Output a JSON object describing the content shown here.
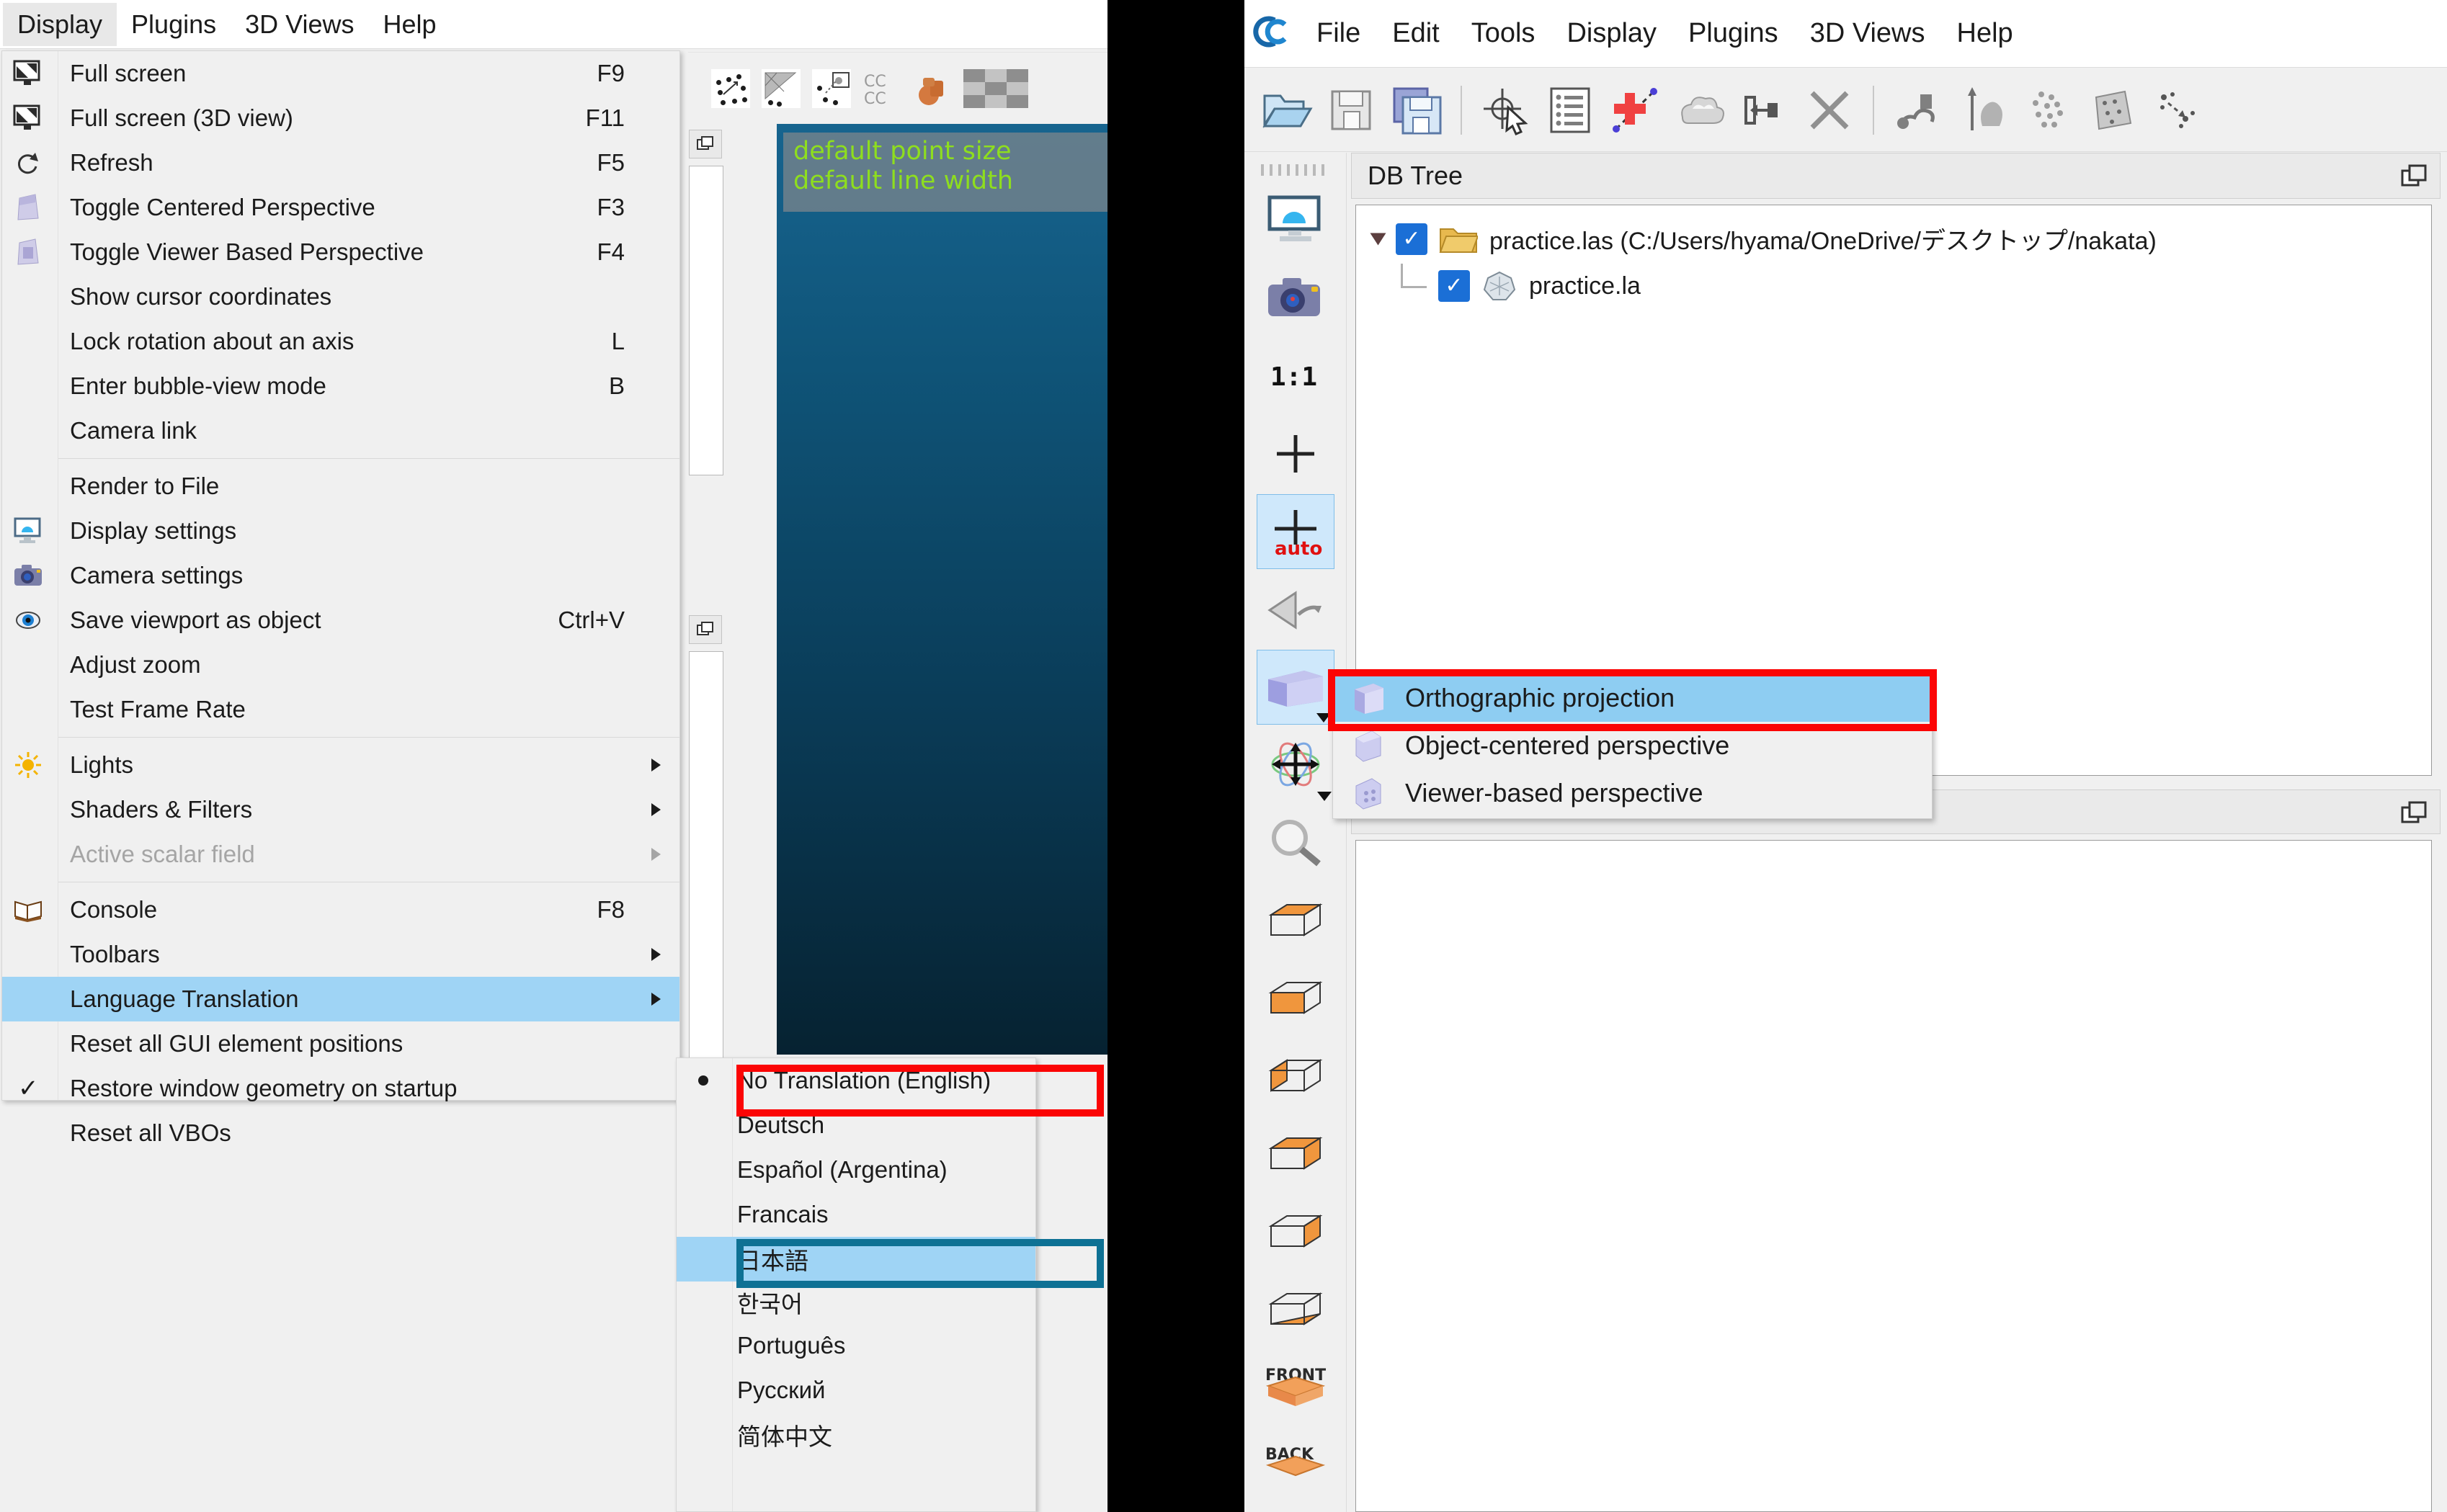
{
  "left_window": {
    "menubar": {
      "items": [
        {
          "label": "Display",
          "active": true
        },
        {
          "label": "Plugins",
          "active": false
        },
        {
          "label": "3D Views",
          "active": false
        },
        {
          "label": "Help",
          "active": false
        }
      ]
    },
    "display_menu": {
      "groups": [
        {
          "items": [
            {
              "label": "Full screen",
              "shortcut": "F9",
              "icon": "fullscreen-icon",
              "arrow": false,
              "checked": false,
              "disabled": false,
              "highlighted": false
            },
            {
              "label": "Full screen (3D view)",
              "shortcut": "F11",
              "icon": "fullscreen-3d-icon",
              "arrow": false,
              "checked": false,
              "disabled": false,
              "highlighted": false
            },
            {
              "label": "Refresh",
              "shortcut": "F5",
              "icon": "refresh-icon",
              "arrow": false,
              "checked": false,
              "disabled": false,
              "highlighted": false
            },
            {
              "label": "Toggle Centered Perspective",
              "shortcut": "F3",
              "icon": "centered-perspective-icon",
              "arrow": false,
              "checked": false,
              "disabled": false,
              "highlighted": false
            },
            {
              "label": "Toggle Viewer Based Perspective",
              "shortcut": "F4",
              "icon": "viewer-perspective-icon",
              "arrow": false,
              "checked": false,
              "disabled": false,
              "highlighted": false
            },
            {
              "label": "Show cursor coordinates",
              "shortcut": "",
              "icon": "",
              "arrow": false,
              "checked": false,
              "disabled": false,
              "highlighted": false
            },
            {
              "label": "Lock rotation about an axis",
              "shortcut": "L",
              "icon": "",
              "arrow": false,
              "checked": false,
              "disabled": false,
              "highlighted": false
            },
            {
              "label": "Enter bubble-view mode",
              "shortcut": "B",
              "icon": "",
              "arrow": false,
              "checked": false,
              "disabled": false,
              "highlighted": false
            },
            {
              "label": "Camera link",
              "shortcut": "",
              "icon": "",
              "arrow": false,
              "checked": false,
              "disabled": false,
              "highlighted": false
            }
          ]
        },
        {
          "items": [
            {
              "label": "Render to File",
              "shortcut": "",
              "icon": "",
              "arrow": false,
              "checked": false,
              "disabled": false,
              "highlighted": false
            },
            {
              "label": "Display settings",
              "shortcut": "",
              "icon": "display-settings-icon",
              "arrow": false,
              "checked": false,
              "disabled": false,
              "highlighted": false
            },
            {
              "label": "Camera settings",
              "shortcut": "",
              "icon": "camera-icon",
              "arrow": false,
              "checked": false,
              "disabled": false,
              "highlighted": false
            },
            {
              "label": "Save viewport as object",
              "shortcut": "Ctrl+V",
              "icon": "eye-icon",
              "arrow": false,
              "checked": false,
              "disabled": false,
              "highlighted": false
            },
            {
              "label": "Adjust zoom",
              "shortcut": "",
              "icon": "",
              "arrow": false,
              "checked": false,
              "disabled": false,
              "highlighted": false
            },
            {
              "label": "Test Frame Rate",
              "shortcut": "",
              "icon": "",
              "arrow": false,
              "checked": false,
              "disabled": false,
              "highlighted": false
            }
          ]
        },
        {
          "items": [
            {
              "label": "Lights",
              "shortcut": "",
              "icon": "sun-icon",
              "arrow": true,
              "checked": false,
              "disabled": false,
              "highlighted": false
            },
            {
              "label": "Shaders & Filters",
              "shortcut": "",
              "icon": "",
              "arrow": true,
              "checked": false,
              "disabled": false,
              "highlighted": false
            },
            {
              "label": "Active scalar field",
              "shortcut": "",
              "icon": "",
              "arrow": true,
              "checked": false,
              "disabled": true,
              "highlighted": false
            }
          ]
        },
        {
          "items": [
            {
              "label": "Console",
              "shortcut": "F8",
              "icon": "book-icon",
              "arrow": false,
              "checked": false,
              "disabled": false,
              "highlighted": false
            },
            {
              "label": "Toolbars",
              "shortcut": "",
              "icon": "",
              "arrow": true,
              "checked": false,
              "disabled": false,
              "highlighted": false
            },
            {
              "label": "Language Translation",
              "shortcut": "",
              "icon": "",
              "arrow": true,
              "checked": false,
              "disabled": false,
              "highlighted": true
            },
            {
              "label": "Reset all GUI element positions",
              "shortcut": "",
              "icon": "",
              "arrow": false,
              "checked": false,
              "disabled": false,
              "highlighted": false
            },
            {
              "label": "Restore window geometry on startup",
              "shortcut": "",
              "icon": "",
              "arrow": false,
              "checked": true,
              "disabled": false,
              "highlighted": false
            },
            {
              "label": "Reset all VBOs",
              "shortcut": "",
              "icon": "",
              "arrow": false,
              "checked": false,
              "disabled": false,
              "highlighted": false
            }
          ]
        }
      ]
    },
    "language_submenu": {
      "items": [
        {
          "label": "No Translation (English)",
          "radio": true,
          "selected": false,
          "outline": "red"
        },
        {
          "label": "Deutsch",
          "radio": false,
          "selected": false,
          "outline": ""
        },
        {
          "label": "Español (Argentina)",
          "radio": false,
          "selected": false,
          "outline": ""
        },
        {
          "label": "Francais",
          "radio": false,
          "selected": false,
          "outline": ""
        },
        {
          "label": "日本語",
          "radio": false,
          "selected": true,
          "outline": "teal"
        },
        {
          "label": "한국어",
          "radio": false,
          "selected": false,
          "outline": ""
        },
        {
          "label": "Português",
          "radio": false,
          "selected": false,
          "outline": ""
        },
        {
          "label": "Русский",
          "radio": false,
          "selected": false,
          "outline": ""
        },
        {
          "label": "简体中文",
          "radio": false,
          "selected": false,
          "outline": ""
        }
      ]
    },
    "viewport": {
      "line1": "default point size",
      "line2": "default line width",
      "text_color": "#8ede1e"
    },
    "toolbar_icons": [
      "point-cloud-icon",
      "mesh-icon",
      "point-picking-icon",
      "cc-cc-icon",
      "clay-pot-icon",
      "checker-icon"
    ]
  },
  "right_window": {
    "menubar": {
      "logo": "cc-logo-icon",
      "items": [
        {
          "label": "File"
        },
        {
          "label": "Edit"
        },
        {
          "label": "Tools"
        },
        {
          "label": "Display"
        },
        {
          "label": "Plugins"
        },
        {
          "label": "3D Views"
        },
        {
          "label": "Help"
        }
      ]
    },
    "toolbar_icons": [
      "open-folder-icon",
      "save-icon",
      "save-all-icon",
      "point-picking-icon",
      "properties-list-icon",
      "add-point-icon",
      "cloud-compare-icon",
      "segment-icon",
      "delete-icon",
      "trace-polyline-icon",
      "normals-icon",
      "subsample-icon",
      "fit-plane-icon",
      "register-icon"
    ],
    "side_toolbar_icons": [
      "display-settings-icon",
      "camera-settings-icon",
      "zoom-1-1-icon",
      "pivot-point-icon",
      "pivot-auto-icon",
      "rotate-view-icon",
      "projection-mode-icon",
      "pan-mode-icon",
      "zoom-mode-icon",
      "view-top-icon",
      "view-bottom-icon",
      "view-left-icon",
      "view-right-icon",
      "view-front-side-icon",
      "view-iso-icon",
      "view-front-icon",
      "view-back-icon"
    ],
    "db_tree_panel": {
      "title": "DB Tree",
      "rows": [
        {
          "indent": 0,
          "expander": true,
          "checked": true,
          "icon": "folder-icon",
          "label": "practice.las (C:/Users/hyama/OneDrive/デスクトップ/nakata)"
        },
        {
          "indent": 1,
          "expander": false,
          "checked": true,
          "icon": "cloud-icon",
          "label": "practice.la"
        }
      ]
    },
    "bottom_panel": {
      "title": ""
    },
    "projection_menu": {
      "items": [
        {
          "label": "Orthographic projection",
          "icon": "ortho-cube-icon",
          "selected": true,
          "outline": "red"
        },
        {
          "label": "Object-centered perspective",
          "icon": "object-persp-icon",
          "selected": false,
          "outline": ""
        },
        {
          "label": "Viewer-based perspective",
          "icon": "viewer-persp-icon",
          "selected": false,
          "outline": ""
        }
      ]
    }
  },
  "colors": {
    "highlight_blue": "#9fd4f5",
    "menu_bg": "#f0f0f0",
    "red_outline": "#fb0505",
    "teal_outline": "#0e7194",
    "viewport_top": "#17648f",
    "viewport_bottom": "#062231",
    "checkbox_blue": "#1b6fd6",
    "green_text": "#8ede1e"
  }
}
